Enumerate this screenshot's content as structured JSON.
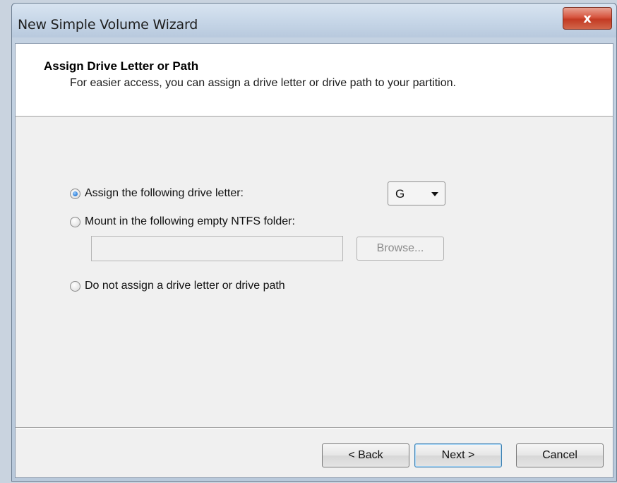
{
  "window": {
    "title": "New Simple Volume Wizard",
    "close_glyph": "x"
  },
  "header": {
    "title": "Assign Drive Letter or Path",
    "subtitle": "For easier access, you can assign a drive letter or drive path to your partition."
  },
  "options": {
    "assign_letter": {
      "label": "Assign the following drive letter:",
      "checked": true
    },
    "mount_folder": {
      "label": "Mount in the following empty NTFS folder:",
      "checked": false
    },
    "no_assign": {
      "label": "Do not assign a drive letter or drive path",
      "checked": false
    }
  },
  "drive_letter": {
    "selected": "G"
  },
  "folder_path": {
    "value": ""
  },
  "browse_label": "Browse...",
  "footer": {
    "back_label": "< Back",
    "next_label": "Next >",
    "cancel_label": "Cancel"
  }
}
